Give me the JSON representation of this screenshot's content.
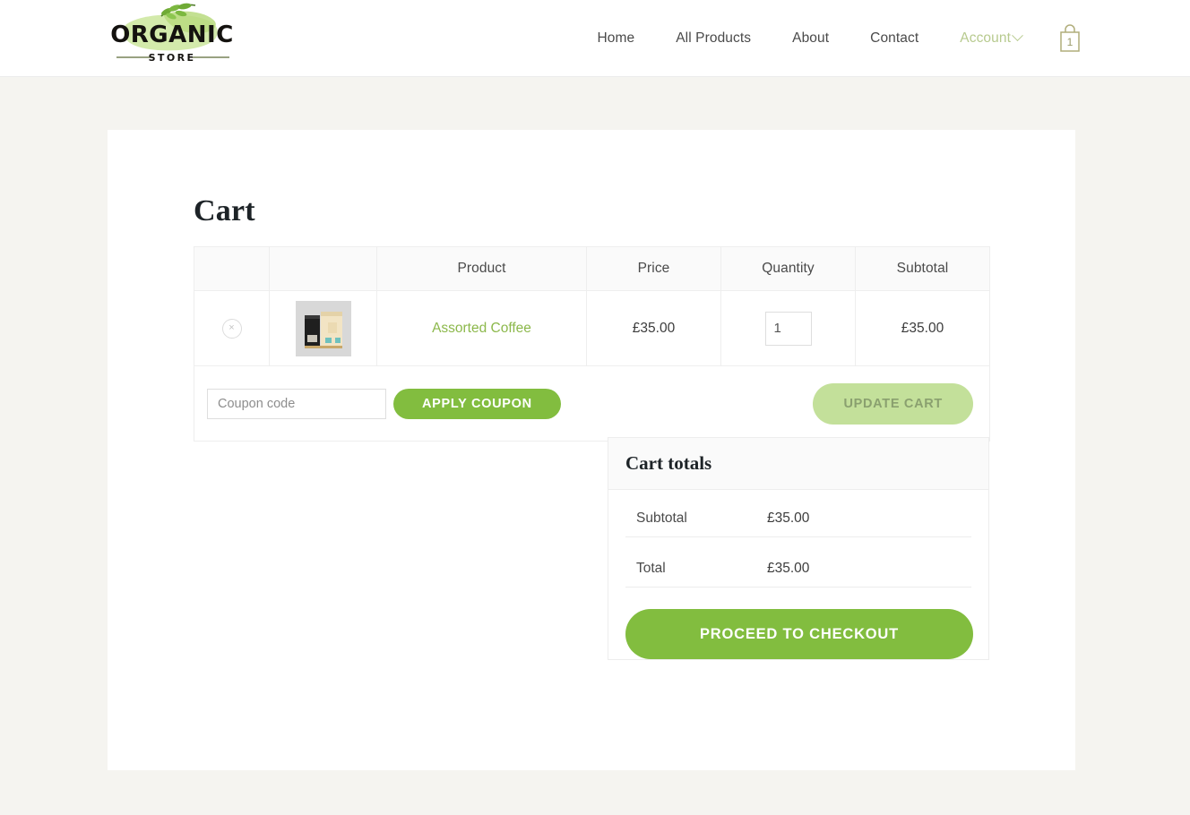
{
  "brand": {
    "name": "ORGANIC",
    "tagline": "STORE",
    "accent": "#82bd3f",
    "leaf_color": "#c7e09a"
  },
  "header": {
    "nav": [
      {
        "label": "Home",
        "active": false
      },
      {
        "label": "All Products",
        "active": false
      },
      {
        "label": "About",
        "active": false
      },
      {
        "label": "Contact",
        "active": false
      }
    ],
    "account": {
      "label": "Account",
      "icon": "chevron-down-icon"
    },
    "cart": {
      "icon": "shopping-bag-icon",
      "count": "1"
    }
  },
  "page": {
    "title": "Cart"
  },
  "cart_table": {
    "columns": [
      "",
      "",
      "Product",
      "Price",
      "Quantity",
      "Subtotal"
    ],
    "headers": {
      "product": "Product",
      "price": "Price",
      "quantity": "Quantity",
      "subtotal": "Subtotal"
    },
    "rows": [
      {
        "remove_icon": "close-circle-icon",
        "remove_glyph": "×",
        "thumbnail": "coffee-bags-thumbnail",
        "name": "Assorted Coffee",
        "price": "£35.00",
        "quantity": "1",
        "subtotal": "£35.00"
      }
    ]
  },
  "coupon": {
    "placeholder": "Coupon code",
    "value": "",
    "apply_label": "APPLY COUPON",
    "update_label": "UPDATE CART",
    "update_disabled": true
  },
  "totals": {
    "title": "Cart totals",
    "rows": [
      {
        "label": "Subtotal",
        "value": "£35.00"
      },
      {
        "label": "Total",
        "value": "£35.00"
      }
    ],
    "checkout_label": "PROCEED TO CHECKOUT"
  }
}
